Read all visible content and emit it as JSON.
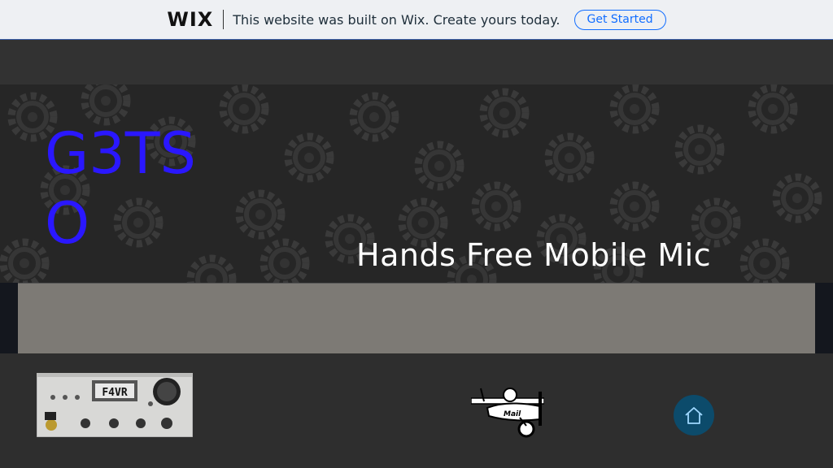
{
  "wix_banner": {
    "logo": "WIX",
    "message": "This website was built on Wix. Create yours today.",
    "cta_label": "Get Started"
  },
  "site": {
    "title": "G3TSO",
    "page_title": "Hands Free Mobile Mic"
  },
  "radio_display": {
    "callsign": "F4VR"
  },
  "plane_image": {
    "label": "Mail"
  },
  "footer": {
    "home_icon": "home-icon"
  },
  "colors": {
    "site_title": "#2a17ff",
    "wix_accent": "#116dff",
    "home_button": "#0c4b6b"
  }
}
